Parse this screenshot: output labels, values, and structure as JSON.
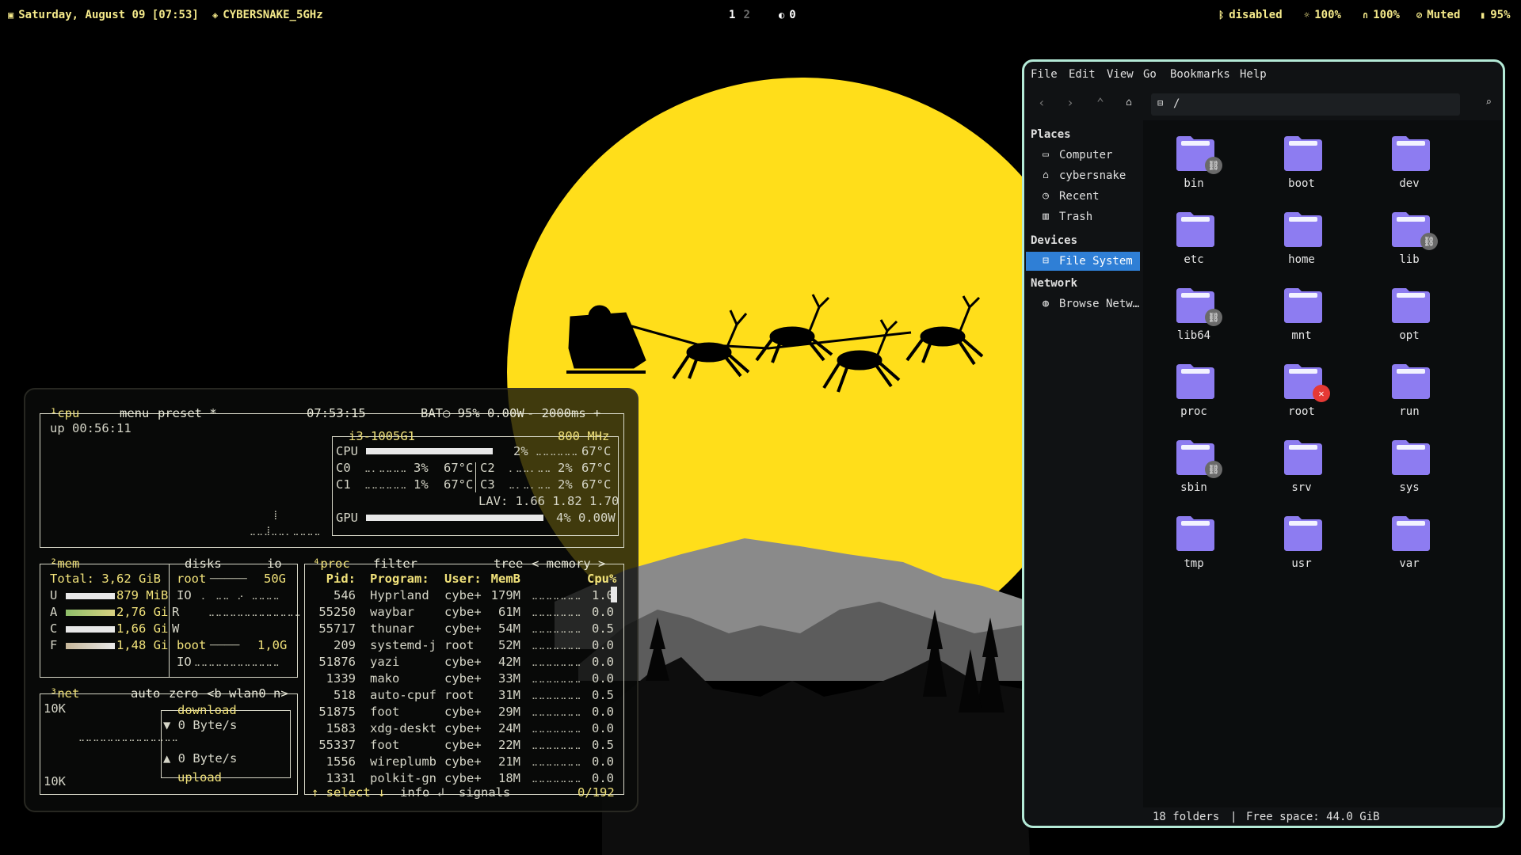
{
  "topbar": {
    "datetime": "Saturday, August 09 [07:53]",
    "wifi": "CYBERSNAKE_5GHz",
    "workspace_active": "1",
    "workspace_inactive": "2",
    "notif_count": "0",
    "bluetooth": "disabled",
    "brightness": "100%",
    "headphones": "100%",
    "mic": "Muted",
    "battery": "95%"
  },
  "btop": {
    "cpu": {
      "title_num": "¹cpu",
      "menu": "menu",
      "preset": "preset *",
      "clock": "07:53:15",
      "bat": "BAT○ 95% 0.00W",
      "interval": "- 2000ms +",
      "uptime": "up 00:56:11",
      "model": "i3-1005G1",
      "freq": "800 MHz",
      "rows": [
        {
          "label": "CPU",
          "pct": "2%",
          "temp": "67°C"
        },
        {
          "label": "C0",
          "pct": "3%",
          "temp": "67°C"
        },
        {
          "label": "C1",
          "pct": "1%",
          "temp": "67°C"
        },
        {
          "label": "C2",
          "pct": "2%",
          "temp": "67°C"
        },
        {
          "label": "C3",
          "pct": "2%",
          "temp": "67°C"
        }
      ],
      "lav": "LAV: 1.66 1.82 1.70",
      "gpu_label": "GPU",
      "gpu_pct": "4% 0.00W"
    },
    "mem": {
      "title": "²mem",
      "total": "Total: 3,62 GiB",
      "rows": [
        {
          "k": "U",
          "v": "879 MiB"
        },
        {
          "k": "A",
          "v": "2,76 Gi"
        },
        {
          "k": "C",
          "v": "1,66 Gi"
        },
        {
          "k": "F",
          "v": "1,48 Gi"
        }
      ],
      "disks_title": "disks",
      "io_title": "io",
      "root_label": "root",
      "root_size": "50G",
      "io_label": "IO",
      "r_label": "R",
      "w_label": "W",
      "boot_label": "boot",
      "boot_size": "1,0G",
      "io2_label": "IO"
    },
    "net": {
      "title": "³net",
      "auto": "auto",
      "zero": "zero",
      "iface": "<b wlan0 n>",
      "top": "10K",
      "bottom": "10K",
      "download": "download",
      "down_rate": "▼ 0 Byte/s",
      "up_rate": "▲ 0 Byte/s",
      "upload": "upload"
    },
    "proc": {
      "title": "⁴proc",
      "filter": "filter",
      "tree": "tree",
      "sort": "< memory >",
      "headers": [
        "Pid:",
        "Program:",
        "User:",
        "MemB",
        "Cpu%"
      ],
      "rows": [
        [
          "546",
          "Hyprland",
          "cybe+",
          "179M",
          "1.0"
        ],
        [
          "55250",
          "waybar",
          "cybe+",
          "61M",
          "0.0"
        ],
        [
          "55717",
          "thunar",
          "cybe+",
          "54M",
          "0.5"
        ],
        [
          "209",
          "systemd-j",
          "root",
          "52M",
          "0.0"
        ],
        [
          "51876",
          "yazi",
          "cybe+",
          "42M",
          "0.0"
        ],
        [
          "1339",
          "mako",
          "cybe+",
          "33M",
          "0.0"
        ],
        [
          "518",
          "auto-cpuf",
          "root",
          "31M",
          "0.5"
        ],
        [
          "51875",
          "foot",
          "cybe+",
          "29M",
          "0.0"
        ],
        [
          "1583",
          "xdg-deskt",
          "cybe+",
          "24M",
          "0.0"
        ],
        [
          "55337",
          "foot",
          "cybe+",
          "22M",
          "0.5"
        ],
        [
          "1556",
          "wireplumb",
          "cybe+",
          "21M",
          "0.0"
        ],
        [
          "1331",
          "polkit-gn",
          "cybe+",
          "18M",
          "0.0"
        ]
      ],
      "footer_select": "↑ select ↓",
      "footer_info": "info ↲",
      "footer_signals": "signals",
      "footer_count": "0/192"
    }
  },
  "filemanager": {
    "menu": [
      "File",
      "Edit",
      "View",
      "Go",
      "Bookmarks",
      "Help"
    ],
    "path": "/",
    "sidebar": {
      "places_header": "Places",
      "places": [
        {
          "icon": "computer-icon",
          "label": "Computer"
        },
        {
          "icon": "home-icon",
          "label": "cybersnake"
        },
        {
          "icon": "recent-icon",
          "label": "Recent"
        },
        {
          "icon": "trash-icon",
          "label": "Trash"
        }
      ],
      "devices_header": "Devices",
      "devices": [
        {
          "icon": "drive-icon",
          "label": "File System"
        }
      ],
      "network_header": "Network",
      "network": [
        {
          "icon": "network-icon",
          "label": "Browse Netw…"
        }
      ]
    },
    "folders": [
      {
        "name": "bin",
        "emblem": "link"
      },
      {
        "name": "boot",
        "emblem": ""
      },
      {
        "name": "dev",
        "emblem": ""
      },
      {
        "name": "etc",
        "emblem": ""
      },
      {
        "name": "home",
        "emblem": ""
      },
      {
        "name": "lib",
        "emblem": "link"
      },
      {
        "name": "lib64",
        "emblem": "link"
      },
      {
        "name": "mnt",
        "emblem": ""
      },
      {
        "name": "opt",
        "emblem": ""
      },
      {
        "name": "proc",
        "emblem": ""
      },
      {
        "name": "root",
        "emblem": "locked"
      },
      {
        "name": "run",
        "emblem": ""
      },
      {
        "name": "sbin",
        "emblem": "link"
      },
      {
        "name": "srv",
        "emblem": ""
      },
      {
        "name": "sys",
        "emblem": ""
      },
      {
        "name": "tmp",
        "emblem": ""
      },
      {
        "name": "usr",
        "emblem": ""
      },
      {
        "name": "var",
        "emblem": ""
      }
    ],
    "status_count": "18 folders",
    "status_sep": "|",
    "status_free": "Free space: 44.0 GiB"
  },
  "colors": {
    "moon": "#ffde1a",
    "folder": "#8d7cf0",
    "accent_border": "#b4ead7",
    "bar_text": "#f4e98a",
    "selection": "#2f7fd6"
  }
}
